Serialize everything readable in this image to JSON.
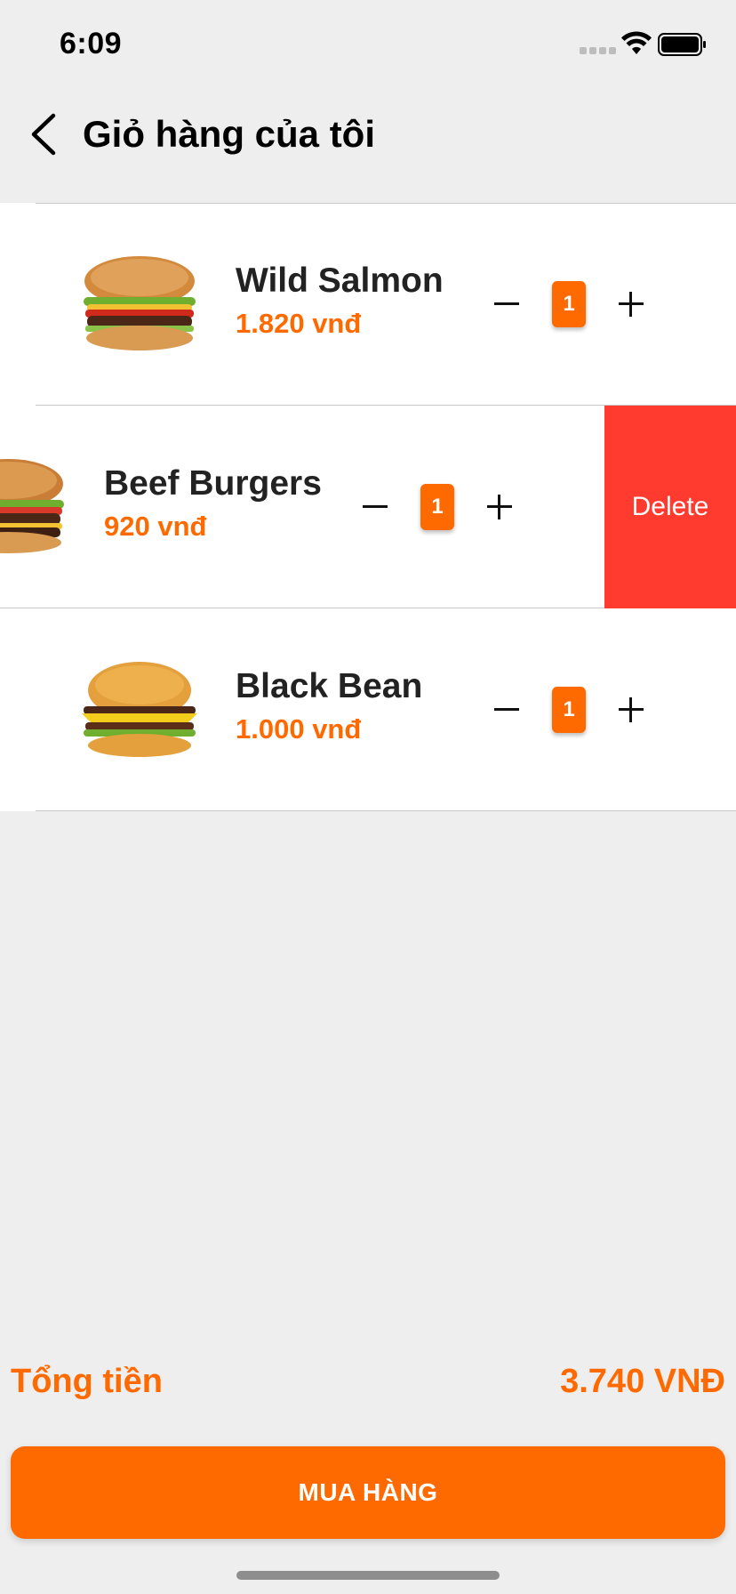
{
  "status_bar": {
    "time": "6:09"
  },
  "header": {
    "title": "Giỏ hàng của tôi",
    "back_icon": "chevron-left-icon"
  },
  "cart": {
    "items": [
      {
        "name": "Wild Salmon",
        "price": "1.820 vnđ",
        "quantity": "1",
        "image_icon": "burger-image",
        "swiped": false
      },
      {
        "name": "Beef Burgers",
        "price": "920 vnđ",
        "quantity": "1",
        "image_icon": "burger-image",
        "swiped": true,
        "delete_label": "Delete"
      },
      {
        "name": "Black Bean",
        "price": "1.000 vnđ",
        "quantity": "1",
        "image_icon": "burger-image",
        "swiped": false
      }
    ]
  },
  "footer": {
    "total_label": "Tổng tiền",
    "total_value": "3.740 VNĐ",
    "buy_label": "MUA HÀNG"
  },
  "colors": {
    "accent": "#ff6a00",
    "delete": "#ff3b30",
    "background": "#eeeeee"
  }
}
